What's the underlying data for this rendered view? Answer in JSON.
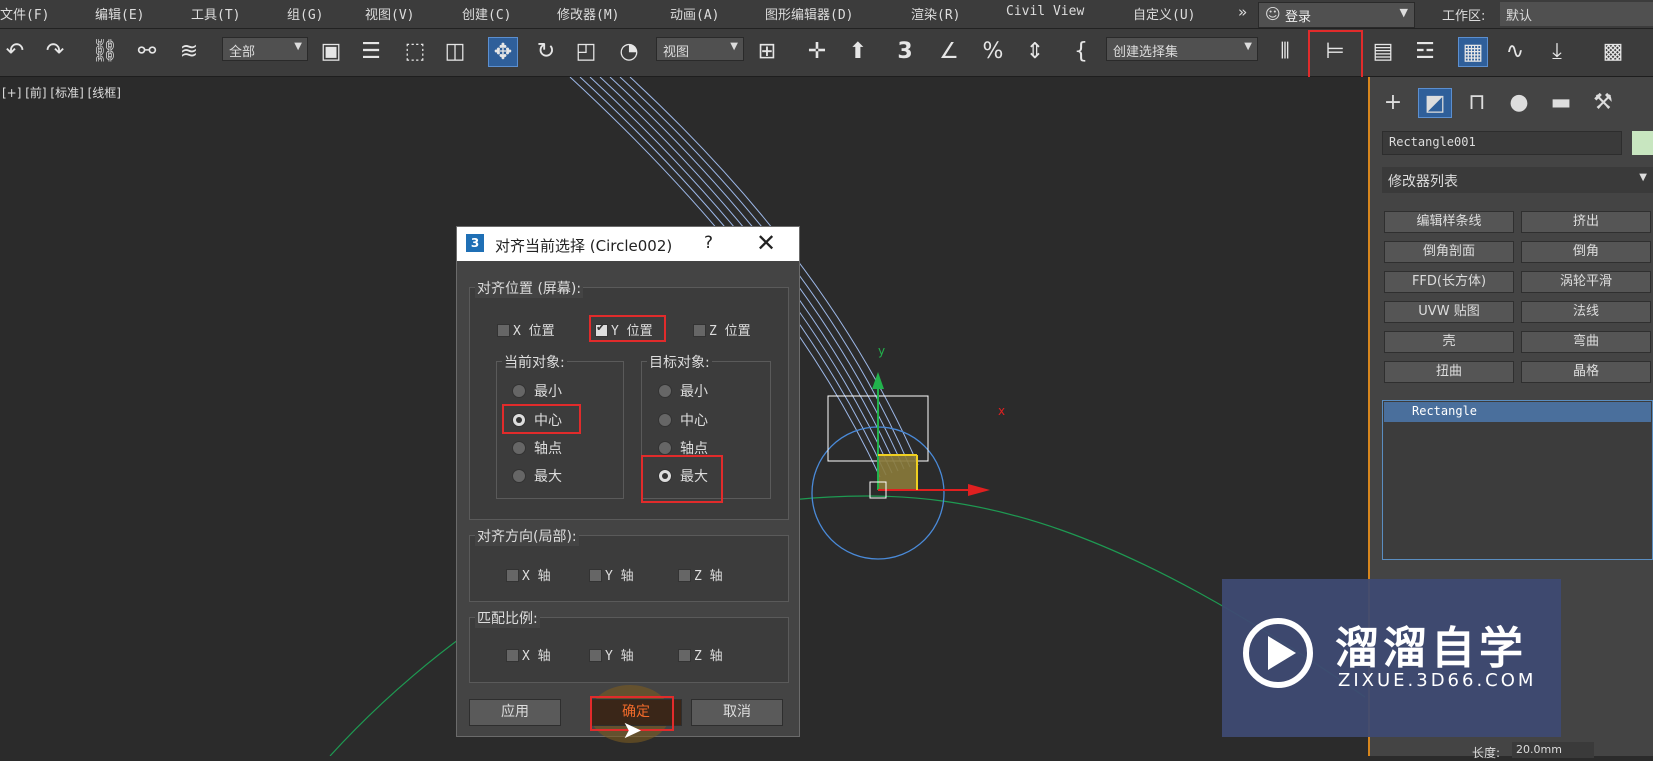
{
  "menu": {
    "items": [
      "文件(F)",
      "编辑(E)",
      "工具(T)",
      "组(G)",
      "视图(V)",
      "创建(C)",
      "修改器(M)",
      "动画(A)",
      "图形编辑器(D)",
      "渲染(R)",
      "Civil View",
      "自定义(U)"
    ],
    "overflow": "»",
    "login": "登录",
    "workspace_label": "工作区:",
    "workspace_value": "默认"
  },
  "toolbar": {
    "selection_filter": "全部",
    "ref_coord": "视图",
    "named_selection": "创建选择集",
    "snap_icon_text": "3",
    "percent_icon": "%",
    "brace_icon": "{"
  },
  "viewport": {
    "label": "[+] [前] [标准] [线框]",
    "axis_x": "x",
    "axis_y": "y"
  },
  "command_panel": {
    "object_name": "Rectangle001",
    "modifier_list": "修改器列表",
    "modifier_buttons": [
      "编辑样条线",
      "挤出",
      "倒角剖面",
      "倒角",
      "FFD(长方体)",
      "涡轮平滑",
      "UVW 贴图",
      "法线",
      "壳",
      "弯曲",
      "扭曲",
      "晶格"
    ],
    "stack_item": "Rectangle",
    "length_label": "长度:",
    "length_value": "20.0mm"
  },
  "watermark": {
    "title": "溜溜自学",
    "subtitle": "ZIXUE.3D66.COM"
  },
  "dialog": {
    "app_icon": "3",
    "title": "对齐当前选择 (Circle002)",
    "help": "?",
    "close": "✕",
    "position_group": "对齐位置 (屏幕):",
    "x_pos": "X 位置",
    "y_pos": "Y 位置",
    "z_pos": "Z 位置",
    "current_group": "当前对象:",
    "target_group": "目标对象:",
    "current_options": [
      "最小",
      "中心",
      "轴点",
      "最大"
    ],
    "target_options": [
      "最小",
      "中心",
      "轴点",
      "最大"
    ],
    "current_selected": "中心",
    "target_selected": "最大",
    "orient_group": "对齐方向(局部):",
    "orient_axes": [
      "X 轴",
      "Y 轴",
      "Z 轴"
    ],
    "scale_group": "匹配比例:",
    "scale_axes": [
      "X 轴",
      "Y 轴",
      "Z 轴"
    ],
    "apply": "应用",
    "ok": "确定",
    "cancel": "取消"
  }
}
